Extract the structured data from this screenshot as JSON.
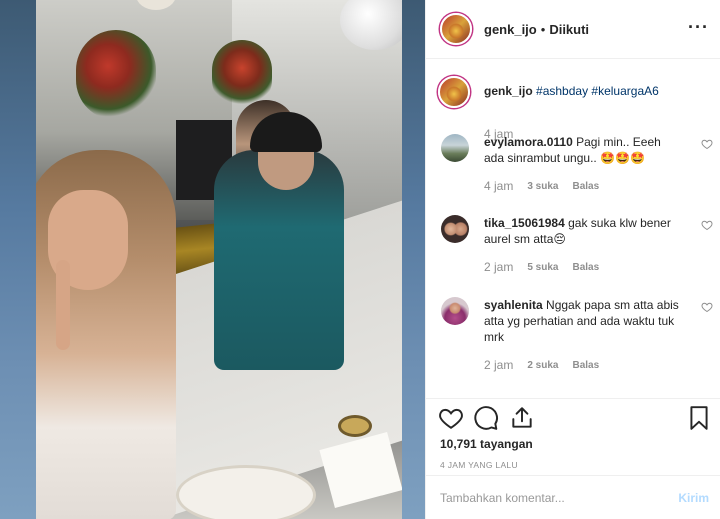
{
  "header": {
    "username": "genk_ijo",
    "separator": "•",
    "follow_status": "Diikuti",
    "more": "···"
  },
  "caption": {
    "username": "genk_ijo",
    "hashtag1": "#ashbday",
    "hashtag2": "#keluargaA6",
    "time": "4 jam"
  },
  "comments": [
    {
      "username": "evylamora.0110",
      "text": "Pagi min.. Eeeh ada sinrambut ungu.. 🤩🤩🤩",
      "time": "4 jam",
      "likes": "3 suka",
      "reply": "Balas"
    },
    {
      "username": "tika_15061984",
      "text": "gak suka klw bener aurel sm atta😔",
      "time": "2 jam",
      "likes": "5 suka",
      "reply": "Balas"
    },
    {
      "username": "syahlenita",
      "text": "Nggak papa sm atta abis atta yg perhatian and ada waktu tuk mrk",
      "time": "2 jam",
      "likes": "2 suka",
      "reply": "Balas"
    }
  ],
  "stats": {
    "views": "10,791 tayangan",
    "time_ago": "4 JAM YANG LALU"
  },
  "add_comment": {
    "placeholder": "Tambahkan komentar...",
    "send_label": "Kirim"
  },
  "colors": {
    "hashtag": "#003569",
    "muted": "#8e8e8e",
    "send_disabled": "#b3dbff",
    "ring": "#c13584"
  },
  "icons": [
    "heart-icon",
    "comment-icon",
    "share-icon",
    "bookmark-icon",
    "more-icon"
  ]
}
